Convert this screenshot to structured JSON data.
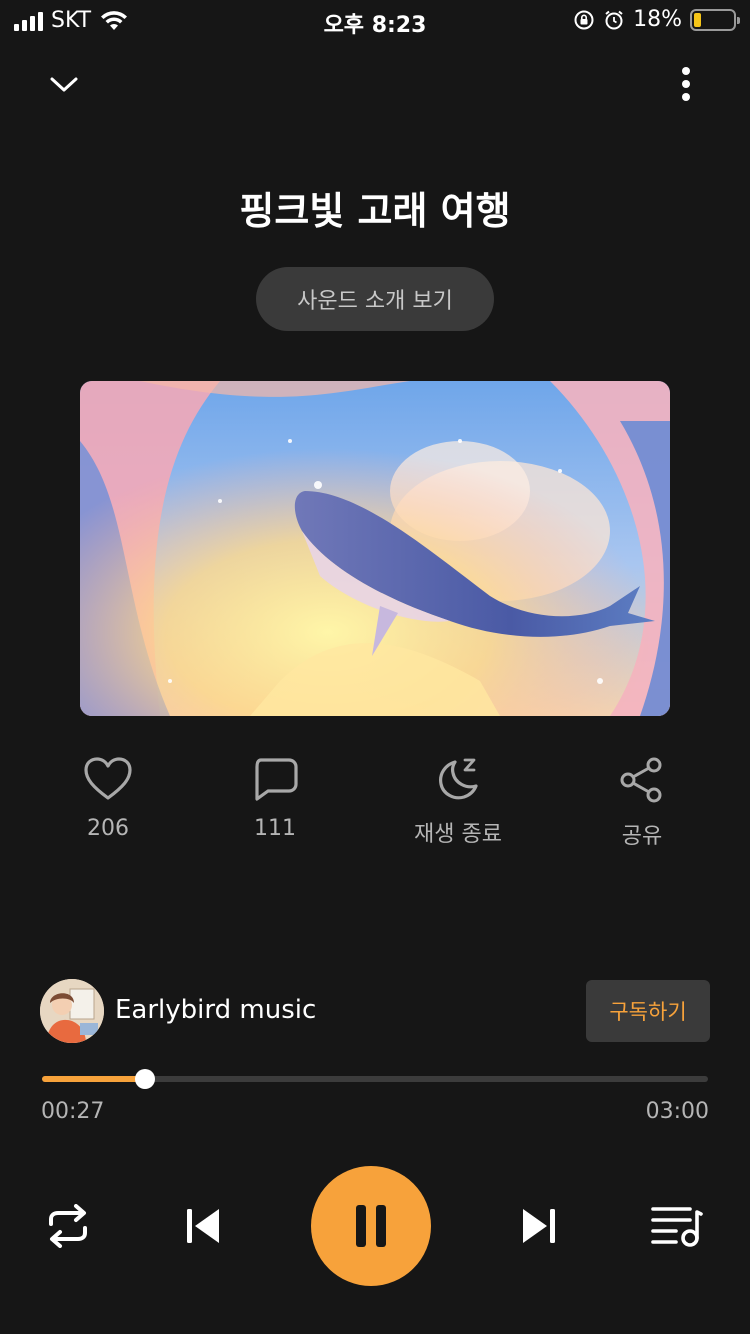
{
  "status_bar": {
    "carrier": "SKT",
    "time": "오후 8:23",
    "battery_percent": "18%",
    "battery_level": 0.18,
    "icons": [
      "signal-icon",
      "wifi-icon",
      "rotation-lock-icon",
      "alarm-icon",
      "battery-icon"
    ]
  },
  "header": {
    "collapse_icon": "chevron-down-icon",
    "more_icon": "more-vertical-icon"
  },
  "track": {
    "title": "핑크빛 고래 여행",
    "intro_button": "사운드 소개 보기",
    "cover_alt": "whale-illustration"
  },
  "actions": {
    "like": {
      "icon": "heart-icon",
      "label": "206"
    },
    "comment": {
      "icon": "comment-icon",
      "label": "111"
    },
    "sleep": {
      "icon": "moon-sleep-icon",
      "label": "재생 종료"
    },
    "share": {
      "icon": "share-icon",
      "label": "공유"
    }
  },
  "artist": {
    "name": "Earlybird music",
    "subscribe_label": "구독하기"
  },
  "player": {
    "elapsed": "00:27",
    "duration": "03:00",
    "progress": 0.155,
    "accent_color": "#f7a23b",
    "controls": [
      "repeat-icon",
      "previous-icon",
      "pause-icon",
      "next-icon",
      "playlist-icon"
    ]
  }
}
